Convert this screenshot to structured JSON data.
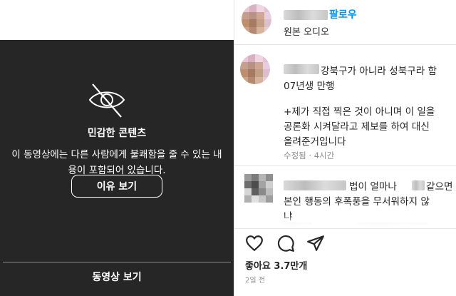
{
  "sensitive": {
    "title": "민감한 콘텐츠",
    "description": "이 동영상에는 다른 사람에게 불쾌함을 줄 수 있는 내용이 포함되어 있습니다.",
    "reason_button": "이유 보기",
    "watch_button": "동영상 보기"
  },
  "header": {
    "follow": "팔로우",
    "audio": "원본 오디오"
  },
  "comments": [
    {
      "lines": [
        "강북구가 아니라 성북구라 함",
        "07년생 만행",
        "+제가 직접 찍은 것이 아니며 이 일을",
        "공론화 시켜달라고 제보를 하여 대신",
        "올려준거입니다"
      ],
      "meta": "수정됨 · 4시간"
    },
    {
      "lines": [
        "법이 얼마나",
        "같으면",
        "본인 행동의 후폭풍을 무서워하지 않",
        "냐"
      ]
    }
  ],
  "actions": {
    "likes": "좋아요 3.7만개",
    "date": "2일 전"
  },
  "icons": [
    "eye-slash-icon",
    "heart-icon",
    "comment-icon",
    "share-icon"
  ],
  "colors": {
    "panel": "#262626",
    "follow": "#0095f6",
    "muted": "#8e8e8e"
  }
}
